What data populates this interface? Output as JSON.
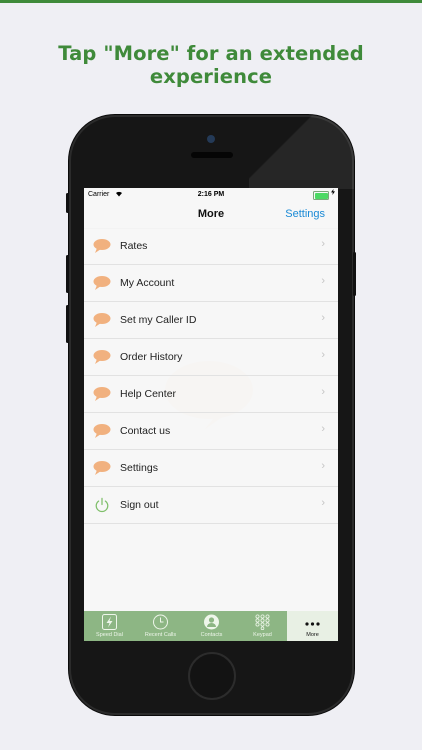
{
  "headline": "Tap \"More\" for an extended experience",
  "status_bar": {
    "carrier": "Carrier",
    "time": "2:16 PM"
  },
  "nav": {
    "title": "More",
    "settings_label": "Settings"
  },
  "menu": {
    "items": [
      {
        "label": "Rates",
        "icon": "speech-bubble-icon"
      },
      {
        "label": "My Account",
        "icon": "speech-bubble-icon"
      },
      {
        "label": "Set my Caller ID",
        "icon": "speech-bubble-icon"
      },
      {
        "label": "Order History",
        "icon": "speech-bubble-icon"
      },
      {
        "label": "Help Center",
        "icon": "speech-bubble-icon"
      },
      {
        "label": "Contact us",
        "icon": "speech-bubble-icon"
      },
      {
        "label": "Settings",
        "icon": "speech-bubble-icon"
      },
      {
        "label": "Sign out",
        "icon": "power-icon"
      }
    ]
  },
  "tabs": [
    {
      "label": "Speed Dial",
      "icon": "lightning-icon"
    },
    {
      "label": "Recent Calls",
      "icon": "clock-icon"
    },
    {
      "label": "Contacts",
      "icon": "person-icon"
    },
    {
      "label": "Keypad",
      "icon": "keypad-icon"
    },
    {
      "label": "More",
      "icon": "more-dots-icon",
      "active": true
    }
  ],
  "colors": {
    "brand_green": "#3f8a3a",
    "tab_bar": "#8db684",
    "link_blue": "#1a8ad6",
    "bubble_orange": "#f1b17f",
    "power_green": "#7fbf6a"
  }
}
